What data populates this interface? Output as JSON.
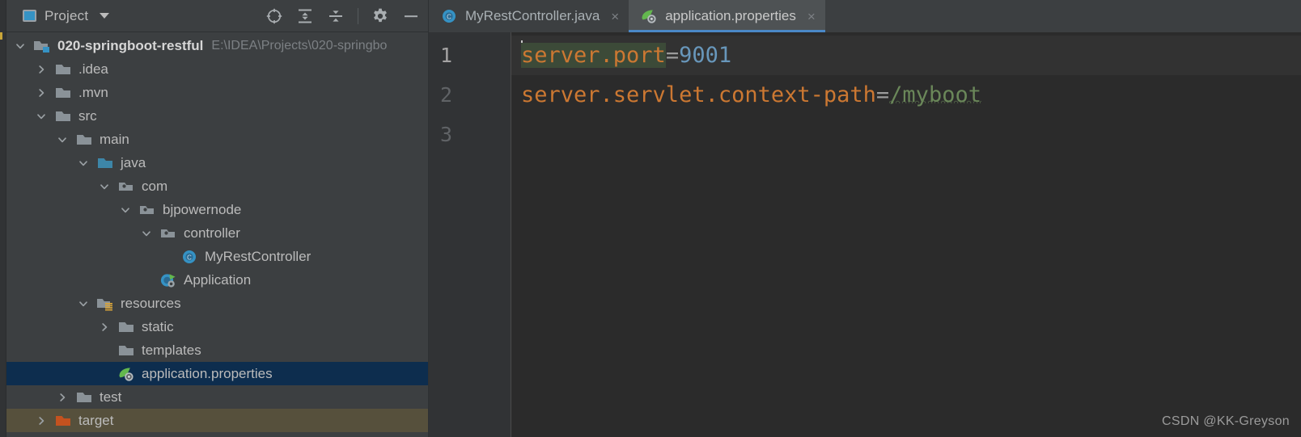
{
  "sidebar": {
    "title": "Project",
    "project_icon": "project-window-icon",
    "dropdown_icon": "chevron-down-icon",
    "tools": [
      {
        "name": "locate-in-tree-icon",
        "label": "Select Opened File"
      },
      {
        "name": "expand-all-icon",
        "label": "Expand All"
      },
      {
        "name": "collapse-all-icon",
        "label": "Collapse All"
      },
      {
        "name": "gear-icon",
        "label": "Settings"
      },
      {
        "name": "minimize-icon",
        "label": "Hide"
      }
    ],
    "tree": [
      {
        "label": "020-springboot-restful",
        "path_hint": "E:\\IDEA\\Projects\\020-springbo",
        "icon": "module-folder-icon",
        "depth": 0,
        "arrow": "expanded",
        "bold": true,
        "state": "normal"
      },
      {
        "label": ".idea",
        "icon": "folder-icon",
        "depth": 1,
        "arrow": "collapsed",
        "bold": false,
        "state": "normal"
      },
      {
        "label": ".mvn",
        "icon": "folder-icon",
        "depth": 1,
        "arrow": "collapsed",
        "bold": false,
        "state": "normal"
      },
      {
        "label": "src",
        "icon": "folder-icon",
        "depth": 1,
        "arrow": "expanded",
        "bold": false,
        "state": "normal"
      },
      {
        "label": "main",
        "icon": "folder-icon",
        "depth": 2,
        "arrow": "expanded",
        "bold": false,
        "state": "normal"
      },
      {
        "label": "java",
        "icon": "source-root-folder-icon",
        "depth": 3,
        "arrow": "expanded",
        "bold": false,
        "state": "normal"
      },
      {
        "label": "com",
        "icon": "package-icon",
        "depth": 4,
        "arrow": "expanded",
        "bold": false,
        "state": "normal"
      },
      {
        "label": "bjpowernode",
        "icon": "package-icon",
        "depth": 5,
        "arrow": "expanded",
        "bold": false,
        "state": "normal"
      },
      {
        "label": "controller",
        "icon": "package-icon",
        "depth": 6,
        "arrow": "expanded",
        "bold": false,
        "state": "normal"
      },
      {
        "label": "MyRestController",
        "icon": "java-class-icon",
        "depth": 7,
        "arrow": "none",
        "bold": false,
        "state": "normal"
      },
      {
        "label": "Application",
        "icon": "spring-boot-class-icon",
        "depth": 6,
        "arrow": "none",
        "bold": false,
        "state": "normal"
      },
      {
        "label": "resources",
        "icon": "resources-root-folder-icon",
        "depth": 3,
        "arrow": "expanded",
        "bold": false,
        "state": "normal"
      },
      {
        "label": "static",
        "icon": "folder-icon",
        "depth": 4,
        "arrow": "collapsed",
        "bold": false,
        "state": "normal"
      },
      {
        "label": "templates",
        "icon": "folder-icon",
        "depth": 4,
        "arrow": "none",
        "bold": false,
        "state": "normal"
      },
      {
        "label": "application.properties",
        "icon": "spring-properties-icon",
        "depth": 4,
        "arrow": "none",
        "bold": false,
        "state": "selected"
      },
      {
        "label": "test",
        "icon": "folder-icon",
        "depth": 2,
        "arrow": "collapsed",
        "bold": false,
        "state": "normal"
      },
      {
        "label": "target",
        "icon": "excluded-folder-icon",
        "depth": 1,
        "arrow": "collapsed",
        "bold": false,
        "state": "excluded"
      }
    ]
  },
  "editor": {
    "tabs": [
      {
        "label": "MyRestController.java",
        "icon": "java-class-icon",
        "close_glyph": "×",
        "active": false
      },
      {
        "label": "application.properties",
        "icon": "spring-properties-icon",
        "close_glyph": "×",
        "active": true
      }
    ],
    "line_numbers": [
      "1",
      "2",
      "3"
    ],
    "lines": [
      {
        "number": "1",
        "current": true,
        "tokens": [
          {
            "text": "server.port",
            "type": "key",
            "selected": true
          },
          {
            "text": "=",
            "type": "eq",
            "selected": false
          },
          {
            "text": "9001",
            "type": "num",
            "selected": false
          }
        ]
      },
      {
        "number": "2",
        "current": false,
        "tokens": [
          {
            "text": "server.servlet.context-path",
            "type": "key",
            "selected": false
          },
          {
            "text": "=",
            "type": "eq",
            "selected": false
          },
          {
            "text": "/myboot",
            "type": "str",
            "selected": false,
            "squiggle": true
          }
        ]
      },
      {
        "number": "3",
        "current": false,
        "tokens": []
      }
    ]
  },
  "watermark": "CSDN @KK-Greyson",
  "colors": {
    "accent_blue": "#4a88c7",
    "selection_row": "#0d2d4e",
    "excluded_row": "#56503c",
    "key_orange": "#cc7832",
    "value_blue": "#6897bb",
    "string_green": "#6a8759",
    "editor_bg": "#2b2b2b",
    "panel_bg": "#3c3f41"
  }
}
